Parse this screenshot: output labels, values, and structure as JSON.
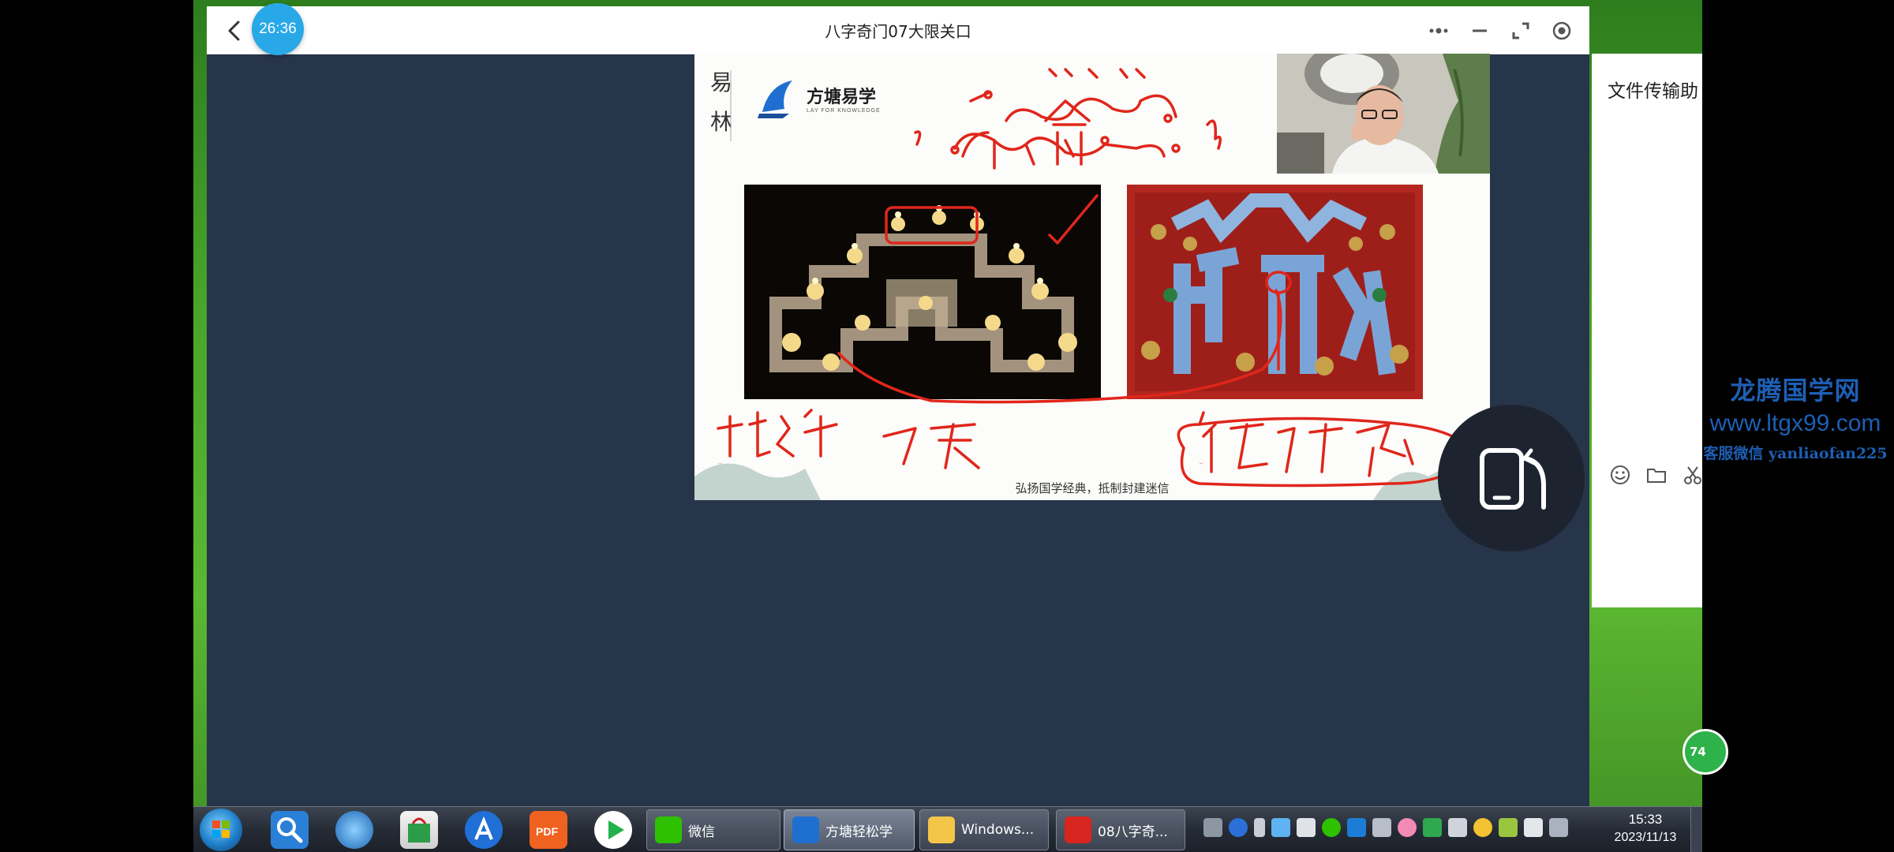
{
  "window": {
    "timer": "26:36",
    "title": "八字奇门07大限关口"
  },
  "slide": {
    "brand_name": "方塘易学",
    "brand_tagline": "LAY FOR KNOWLEDGE",
    "motto": "弘扬国学经典，抵制封建迷信",
    "handwriting": {
      "top_numbers_left": "7",
      "top_numbers_right": "6",
      "bottom_left": "北斗经 7天",
      "bottom_right": "供护法桌"
    }
  },
  "side_panel": {
    "title": "文件传输助"
  },
  "watermark": {
    "name": "龙腾国学网",
    "url": "www.ltgx99.com",
    "wechat": "客服微信 yanliaofan225"
  },
  "badge": {
    "text": "74"
  },
  "taskbar": {
    "tasks": [
      {
        "label": "微信"
      },
      {
        "label": "方塘轻松学"
      },
      {
        "label": "Windows..."
      },
      {
        "label": "08八字奇..."
      }
    ],
    "clock": {
      "time": "15:33",
      "date": "2023/11/13"
    }
  },
  "colors": {
    "accent": "#29a8e8",
    "ink": "#e0261b",
    "watermark": "#1e5fb4",
    "meeting_bg": "#27354a"
  }
}
